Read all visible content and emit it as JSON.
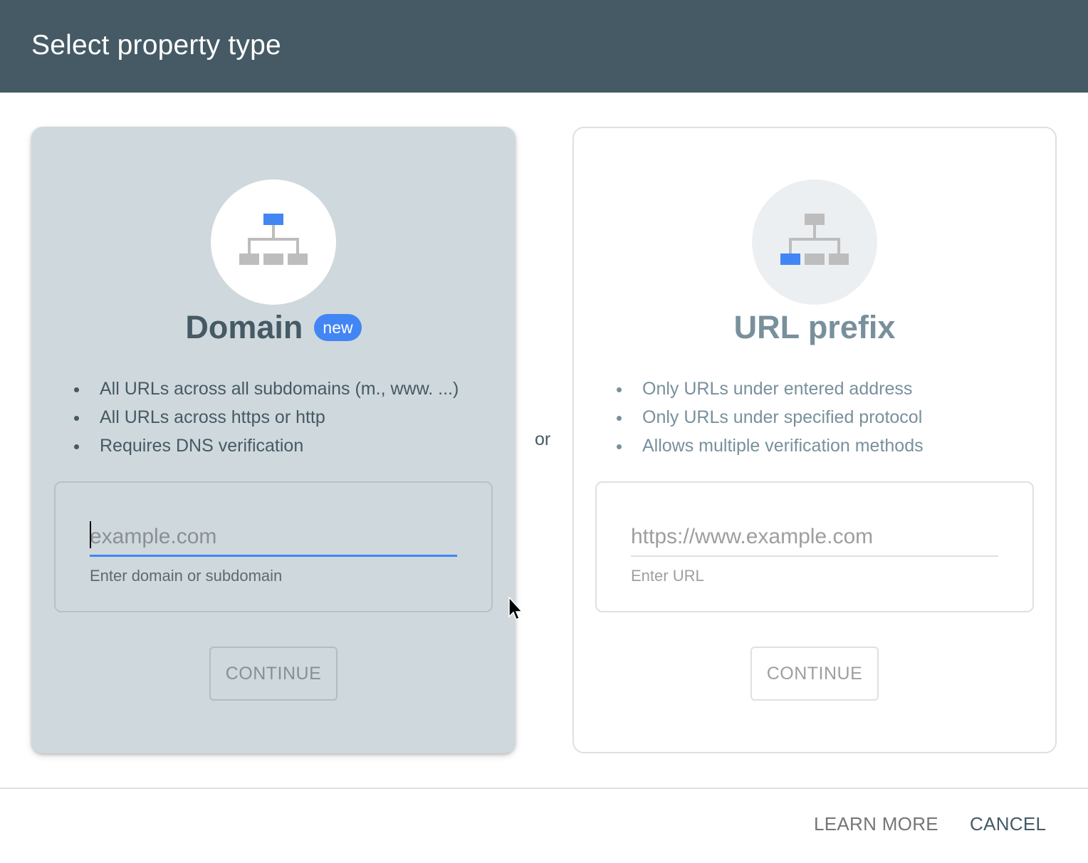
{
  "dialog": {
    "title": "Select property type"
  },
  "colors": {
    "header_bg": "#455a64",
    "accent": "#4285f4",
    "domain_card_bg": "#cfd8dc",
    "node_gray": "#bdbdbd"
  },
  "domain_option": {
    "icon": "sitemap-icon",
    "title": "Domain",
    "badge": "new",
    "bullets": [
      "All URLs across all subdomains (m., www. ...)",
      "All URLs across https or http",
      "Requires DNS verification"
    ],
    "input": {
      "value": "",
      "placeholder": "example.com",
      "helper": "Enter domain or subdomain"
    },
    "continue_label": "CONTINUE",
    "selected": true
  },
  "separator": "or",
  "url_prefix_option": {
    "icon": "sitemap-icon",
    "title": "URL prefix",
    "bullets": [
      "Only URLs under entered address",
      "Only URLs under specified protocol",
      "Allows multiple verification methods"
    ],
    "input": {
      "value": "",
      "placeholder": "https://www.example.com",
      "helper": "Enter URL"
    },
    "continue_label": "CONTINUE",
    "selected": false
  },
  "footer": {
    "learn_more_label": "LEARN MORE",
    "cancel_label": "CANCEL"
  }
}
